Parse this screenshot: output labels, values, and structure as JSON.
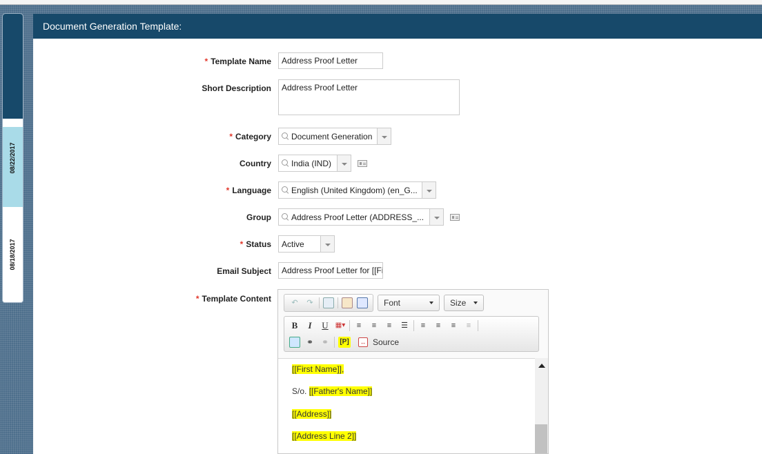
{
  "sidebar": {
    "date_active": "08/22/2017",
    "date_other": "08/18/2017"
  },
  "panel": {
    "title": "Document Generation Template:"
  },
  "form": {
    "template_name": {
      "label": "Template Name",
      "required": "*",
      "value": "Address Proof Letter"
    },
    "short_description": {
      "label": "Short Description",
      "value": "Address Proof Letter"
    },
    "category": {
      "label": "Category",
      "required": "*",
      "value": "Document Generation"
    },
    "country": {
      "label": "Country",
      "value": "India (IND)"
    },
    "language": {
      "label": "Language",
      "required": "*",
      "value": "English (United Kingdom) (en_G..."
    },
    "group": {
      "label": "Group",
      "value": "Address Proof Letter (ADDRESS_..."
    },
    "status": {
      "label": "Status",
      "required": "*",
      "value": "Active"
    },
    "email_subject": {
      "label": "Email Subject",
      "value": "Address Proof Letter for [[Fir"
    },
    "template_content": {
      "label": "Template Content",
      "required": "*"
    }
  },
  "editor": {
    "font_label": "Font",
    "size_label": "Size",
    "bold": "B",
    "italic": "I",
    "underline": "U",
    "placeholder_icon": "[P]",
    "source_label": "Source",
    "lines": {
      "l1": "[[First Name]],",
      "l1_suffix": "",
      "l2_prefix": "S/o. ",
      "l2": "[[Father's Name]]",
      "l3": "[[Address]]",
      "l4": "[[Address Line 2]]"
    },
    "icons": [
      "undo-icon",
      "redo-icon",
      "table-icon",
      "edit-image-icon",
      "image-icon",
      "text-color-icon",
      "align-left-icon",
      "align-center-icon",
      "align-right-icon",
      "justify-icon",
      "numbered-list-icon",
      "bullet-list-icon",
      "indent-icon",
      "outdent-icon",
      "save-icon",
      "link-icon",
      "unlink-icon",
      "placeholder-icon",
      "source-icon"
    ]
  },
  "colors": {
    "header": "#17496a",
    "required": "#e2372b",
    "highlight": "#ffff00",
    "status_green": "#63c12b"
  }
}
